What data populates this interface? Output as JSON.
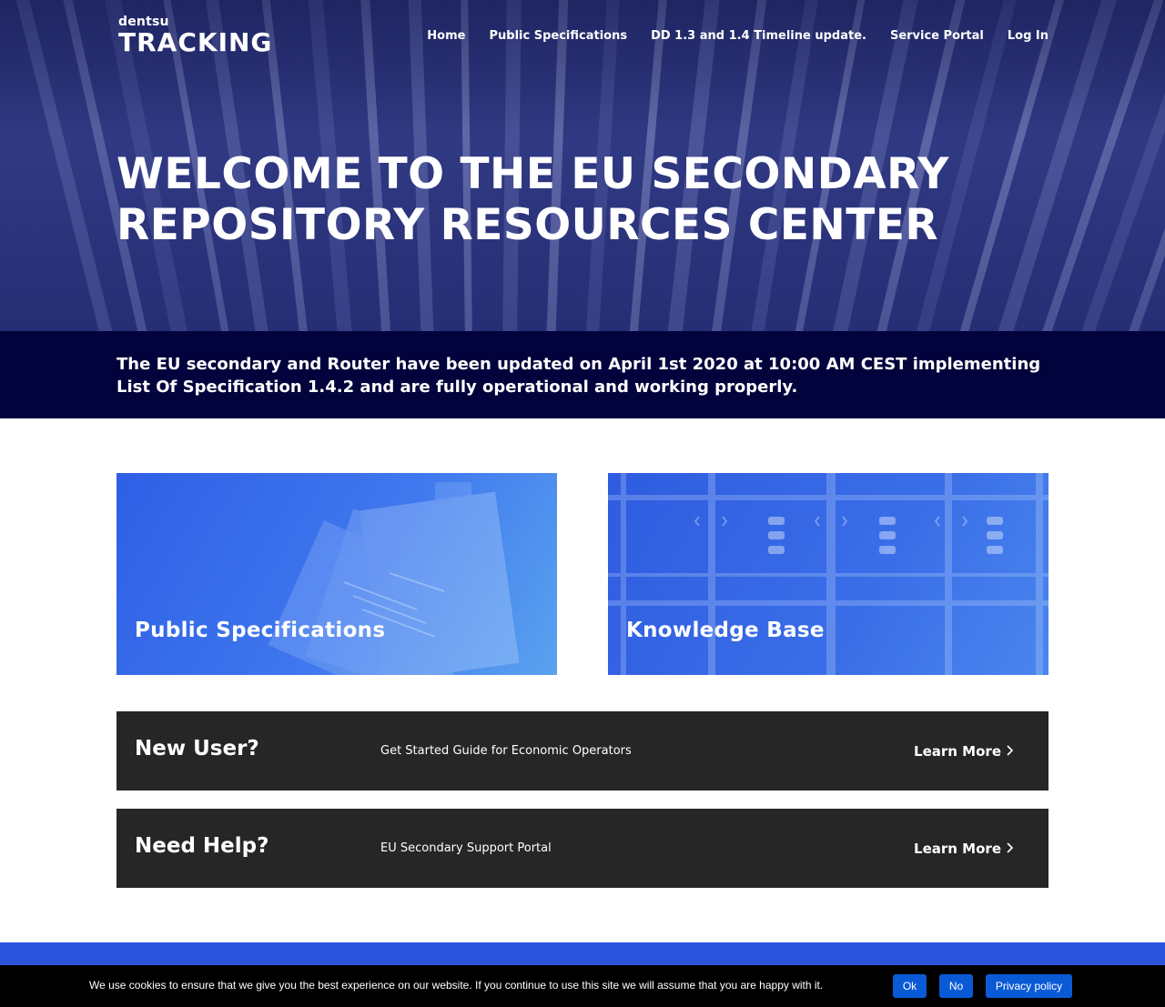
{
  "header": {
    "logo_small": "dentsu",
    "logo_big": "TRACKING",
    "nav": [
      "Home",
      "Public Specifications",
      "DD 1.3 and 1.4 Timeline update.",
      "Service Portal",
      "Log In"
    ]
  },
  "hero": {
    "title_line1": "WELCOME TO THE EU SECONDARY",
    "title_line2": "REPOSITORY RESOURCES CENTER"
  },
  "notice": {
    "line1": "The EU secondary and Router have been updated on April 1st 2020 at 10:00 AM CEST implementing",
    "line2": "List Of Specification 1.4.2 and are fully operational and working properly."
  },
  "cards": [
    {
      "title": "Public Specifications"
    },
    {
      "title": "Knowledge Base"
    }
  ],
  "cta": [
    {
      "title": "New User?",
      "description": "Get Started Guide for Economic Operators",
      "link": "Learn More"
    },
    {
      "title": "Need Help?",
      "description": "EU Secondary Support Portal",
      "link": "Learn More"
    }
  ],
  "cookie": {
    "text": "We use cookies to ensure that we give you the best experience on our website. If you continue to use this site we will assume that you are happy with it.",
    "ok": "Ok",
    "no": "No",
    "privacy": "Privacy policy"
  },
  "colors": {
    "notice_band": "#02033c",
    "cta_bar": "#262626",
    "footer": "#2c53dc",
    "cookie_button": "#0a5ad6"
  }
}
